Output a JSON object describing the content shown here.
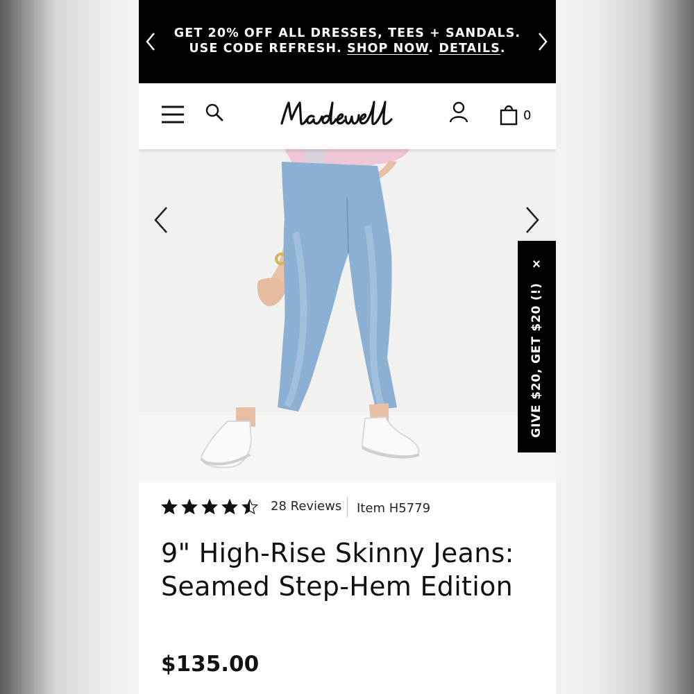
{
  "promo": {
    "text": "GET 20% OFF ALL DRESSES, TEES + SANDALS. USE CODE REFRESH.",
    "shop_now": "SHOP NOW",
    "details": "DETAILS"
  },
  "header": {
    "brand": "Madewell",
    "bag_count": "0"
  },
  "referral": {
    "label": "GIVE $20, GET $20 (!)",
    "close": "×"
  },
  "product": {
    "rating_stars": 4.5,
    "reviews": "28 Reviews",
    "item": "Item H5779",
    "title": "9\" High-Rise Skinny Jeans: Seamed Step-Hem Edition",
    "price": "$135.00"
  },
  "icons": [
    "chevron-left-icon",
    "chevron-right-icon",
    "hamburger-menu-icon",
    "search-icon",
    "account-icon",
    "shopping-bag-icon",
    "star-icon",
    "close-icon"
  ]
}
